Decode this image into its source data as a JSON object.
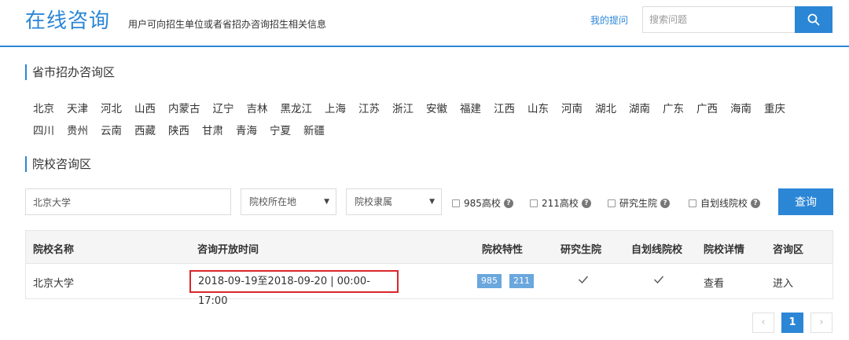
{
  "header": {
    "title": "在线咨询",
    "subtitle": "用户可向招生单位或者省招办咨询招生相关信息",
    "my_questions_link": "我的提问",
    "search_placeholder": "搜索问题"
  },
  "province_section": {
    "title": "省市招办咨询区",
    "row1": [
      "北京",
      "天津",
      "河北",
      "山西",
      "内蒙古",
      "辽宁",
      "吉林",
      "黑龙江",
      "上海",
      "江苏",
      "浙江",
      "安徽",
      "福建",
      "江西",
      "山东",
      "河南",
      "湖北",
      "湖南",
      "广东",
      "广西",
      "海南",
      "重庆"
    ],
    "row2": [
      "四川",
      "贵州",
      "云南",
      "西藏",
      "陕西",
      "甘肃",
      "青海",
      "宁夏",
      "新疆"
    ]
  },
  "school_section": {
    "title": "院校咨询区",
    "school_input_value": "北京大学",
    "location_select": "院校所在地",
    "affiliation_select": "院校隶属",
    "checkboxes": [
      "985高校",
      "211高校",
      "研究生院",
      "自划线院校"
    ],
    "query_button": "查询"
  },
  "table": {
    "headers": [
      "院校名称",
      "咨询开放时间",
      "院校特性",
      "研究生院",
      "自划线院校",
      "院校详情",
      "咨询区"
    ],
    "rows": [
      {
        "name": "北京大学",
        "time": "2018-09-19至2018-09-20 | 00:00-17:00",
        "badges": [
          "985",
          "211"
        ],
        "graduate_school": true,
        "self_line": true,
        "detail": "查看",
        "enter": "进入"
      }
    ]
  },
  "pagination": {
    "prev": "‹",
    "current": "1",
    "next": "›"
  },
  "colors": {
    "accent": "#2b86d6",
    "highlight": "#d9262c",
    "badge": "#6aa7dd"
  }
}
